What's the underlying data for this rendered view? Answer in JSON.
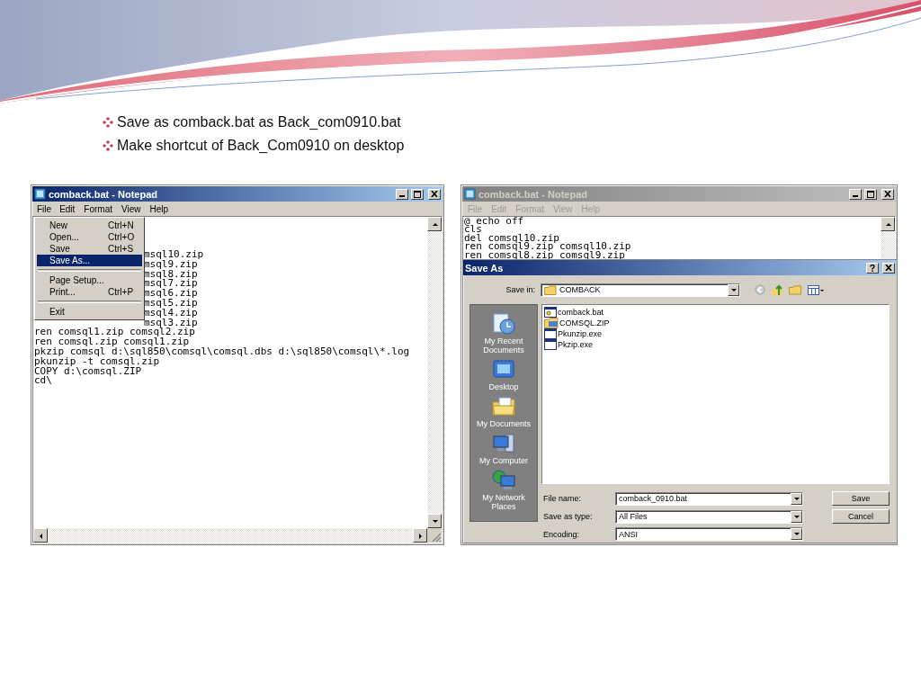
{
  "slide": {
    "bullets": [
      "Save as comback.bat as Back_com0910.bat",
      "Make shortcut of Back_Com0910 on desktop"
    ]
  },
  "notepad_left": {
    "title": "comback.bat - Notepad",
    "active": true,
    "menu_bar": [
      {
        "label": "File",
        "selected": true
      },
      {
        "label": "Edit",
        "selected": false
      },
      {
        "label": "Format",
        "selected": false
      },
      {
        "label": "View",
        "selected": false
      },
      {
        "label": "Help",
        "selected": false
      }
    ],
    "file_menu": [
      {
        "kind": "item",
        "label": "New",
        "shortcut": "Ctrl+N",
        "selected": false
      },
      {
        "kind": "item",
        "label": "Open...",
        "shortcut": "Ctrl+O",
        "selected": false
      },
      {
        "kind": "item",
        "label": "Save",
        "shortcut": "Ctrl+S",
        "selected": false
      },
      {
        "kind": "item",
        "label": "Save As...",
        "selected": true
      },
      {
        "kind": "separator"
      },
      {
        "kind": "item",
        "label": "Page Setup...",
        "selected": false
      },
      {
        "kind": "item",
        "label": "Print...",
        "shortcut": "Ctrl+P",
        "selected": false
      },
      {
        "kind": "separator"
      },
      {
        "kind": "item",
        "label": "Exit",
        "selected": false
      }
    ],
    "lines_beside_menu": [
      {
        "text": "msql10.zip"
      },
      {
        "text": "msql9.zip"
      },
      {
        "text": "msql8.zip"
      },
      {
        "text": "msql7.zip"
      },
      {
        "text": "msql6.zip"
      },
      {
        "text": "msql5.zip"
      },
      {
        "text": "msql4.zip"
      },
      {
        "text": "msql3.zip"
      }
    ],
    "lines": [
      {
        "text": "ren comsql1.zip comsql2.zip"
      },
      {
        "text": "ren comsql.zip comsql1.zip"
      },
      {
        "text": "pkzip comsql d:\\sql850\\comsql\\comsql.dbs d:\\sql850\\comsql\\*.log"
      },
      {
        "text": "pkunzip -t comsql.zip"
      },
      {
        "text": "COPY d:\\comsql.ZIP"
      },
      {
        "text": "cd\\"
      }
    ]
  },
  "notepad_right": {
    "title": "comback.bat - Notepad",
    "active": false,
    "menu_bar": [
      {
        "label": "File",
        "selected": false
      },
      {
        "label": "Edit",
        "selected": false
      },
      {
        "label": "Format",
        "selected": false
      },
      {
        "label": "View",
        "selected": false
      },
      {
        "label": "Help",
        "selected": false
      }
    ],
    "lines": [
      {
        "text": "@ echo off"
      },
      {
        "text": "cls"
      },
      {
        "text": "del comsql10.zip"
      },
      {
        "text": "ren comsql9.zip comsql10.zip"
      },
      {
        "text": "ren comsql8.zip comsql9.zip"
      }
    ]
  },
  "save_as_dialog": {
    "title": "Save As",
    "save_in_label": "Save in:",
    "save_in_value": "COMBACK",
    "places": [
      {
        "label": "My Recent Documents",
        "kind": "recent"
      },
      {
        "label": "Desktop",
        "kind": "desktop"
      },
      {
        "label": "My Documents",
        "kind": "documents"
      },
      {
        "label": "My Computer",
        "kind": "computer"
      },
      {
        "label": "My Network Places",
        "kind": "network"
      }
    ],
    "files": [
      {
        "name": "comback.bat",
        "kind": "batch"
      },
      {
        "name": "COMSQL.ZIP",
        "kind": "zip"
      },
      {
        "name": "Pkunzip.exe",
        "kind": "exe"
      },
      {
        "name": "Pkzip.exe",
        "kind": "exe"
      }
    ],
    "fields": [
      {
        "label": "File name:",
        "value": "comback_0910.bat"
      },
      {
        "label": "Save as type:",
        "value": "All Files"
      },
      {
        "label": "Encoding:",
        "value": "ANSI"
      }
    ],
    "buttons": [
      "Save",
      "Cancel"
    ]
  }
}
